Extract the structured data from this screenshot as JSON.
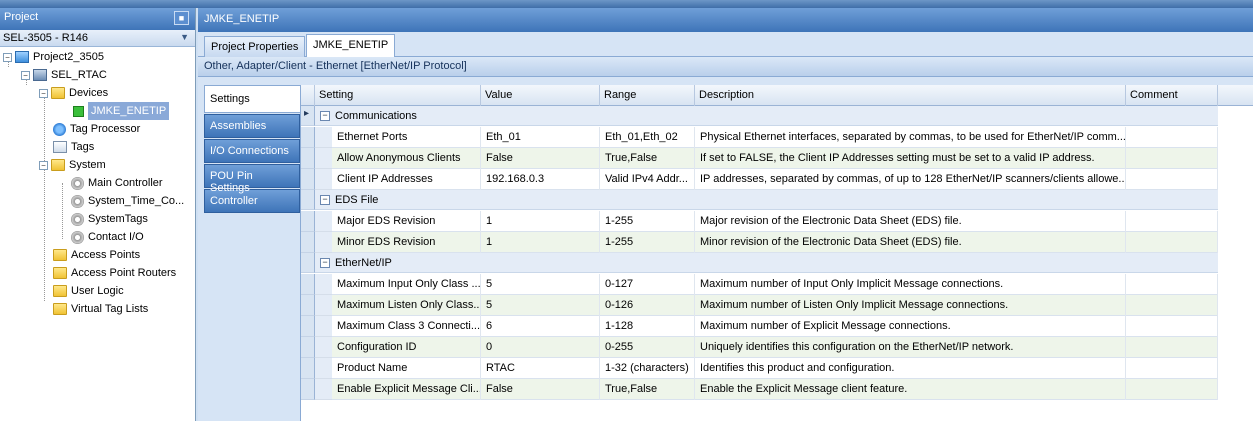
{
  "project_pane": {
    "title": "Project",
    "device_selector": "SEL-3505 - R146",
    "tree": {
      "project": "Project2_3505",
      "rtac": "SEL_RTAC",
      "devices": "Devices",
      "device_item": "JMKE_ENETIP",
      "tag_processor": "Tag Processor",
      "tags": "Tags",
      "system": "System",
      "main_controller": "Main Controller",
      "system_time": "System_Time_Co...",
      "system_tags": "SystemTags",
      "contact_io": "Contact I/O",
      "access_points": "Access Points",
      "access_point_routers": "Access Point Routers",
      "user_logic": "User Logic",
      "virtual_tag_lists": "Virtual Tag Lists"
    }
  },
  "document": {
    "title": "JMKE_ENETIP",
    "tabs": [
      "Project Properties",
      "JMKE_ENETIP"
    ],
    "subheader": "Other, Adapter/Client - Ethernet  [EtherNet/IP Protocol]",
    "side_tabs": [
      "Settings",
      "Assemblies",
      "I/O Connections",
      "POU Pin Settings",
      "Controller"
    ]
  },
  "grid": {
    "columns": [
      "Setting",
      "Value",
      "Range",
      "Description",
      "Comment"
    ],
    "categories": [
      {
        "name": "Communications",
        "rows": [
          {
            "setting": "Ethernet Ports",
            "value": "Eth_01",
            "range": "Eth_01,Eth_02",
            "description": "Physical Ethernet interfaces, separated by commas, to be used for EtherNet/IP comm...",
            "comment": ""
          },
          {
            "setting": "Allow Anonymous Clients",
            "value": "False",
            "range": "True,False",
            "description": "If set to FALSE, the Client IP Addresses setting must be set to a valid IP address.",
            "comment": ""
          },
          {
            "setting": "Client IP Addresses",
            "value": "192.168.0.3",
            "range": "Valid IPv4 Addr...",
            "description": "IP addresses, separated by commas, of up to 128 EtherNet/IP scanners/clients allowe...",
            "comment": ""
          }
        ]
      },
      {
        "name": "EDS File",
        "rows": [
          {
            "setting": "Major EDS Revision",
            "value": "1",
            "range": "1-255",
            "description": "Major revision of the Electronic Data Sheet (EDS) file.",
            "comment": ""
          },
          {
            "setting": "Minor EDS Revision",
            "value": "1",
            "range": "1-255",
            "description": "Minor revision of the Electronic Data Sheet (EDS) file.",
            "comment": ""
          }
        ]
      },
      {
        "name": "EtherNet/IP",
        "rows": [
          {
            "setting": "Maximum Input Only Class ...",
            "value": "5",
            "range": "0-127",
            "description": "Maximum number of Input Only Implicit Message connections.",
            "comment": ""
          },
          {
            "setting": "Maximum Listen Only Class...",
            "value": "5",
            "range": "0-126",
            "description": "Maximum number of Listen Only Implicit Message connections.",
            "comment": ""
          },
          {
            "setting": "Maximum Class 3 Connecti...",
            "value": "6",
            "range": "1-128",
            "description": "Maximum number of Explicit Message connections.",
            "comment": ""
          },
          {
            "setting": "Configuration ID",
            "value": "0",
            "range": "0-255",
            "description": "Uniquely identifies this configuration on the EtherNet/IP network.",
            "comment": ""
          },
          {
            "setting": "Product Name",
            "value": "RTAC",
            "range": "1-32 (characters)",
            "description": "Identifies this product and configuration.",
            "comment": ""
          },
          {
            "setting": "Enable Explicit Message Cli...",
            "value": "False",
            "range": "True,False",
            "description": "Enable the Explicit Message client feature.",
            "comment": ""
          }
        ]
      }
    ]
  },
  "icons": [
    "pin-icon",
    "dropdown-icon",
    "folder-icon",
    "gear-icon",
    "device-status-icon",
    "expand-icon",
    "collapse-icon",
    "row-pointer-icon"
  ]
}
